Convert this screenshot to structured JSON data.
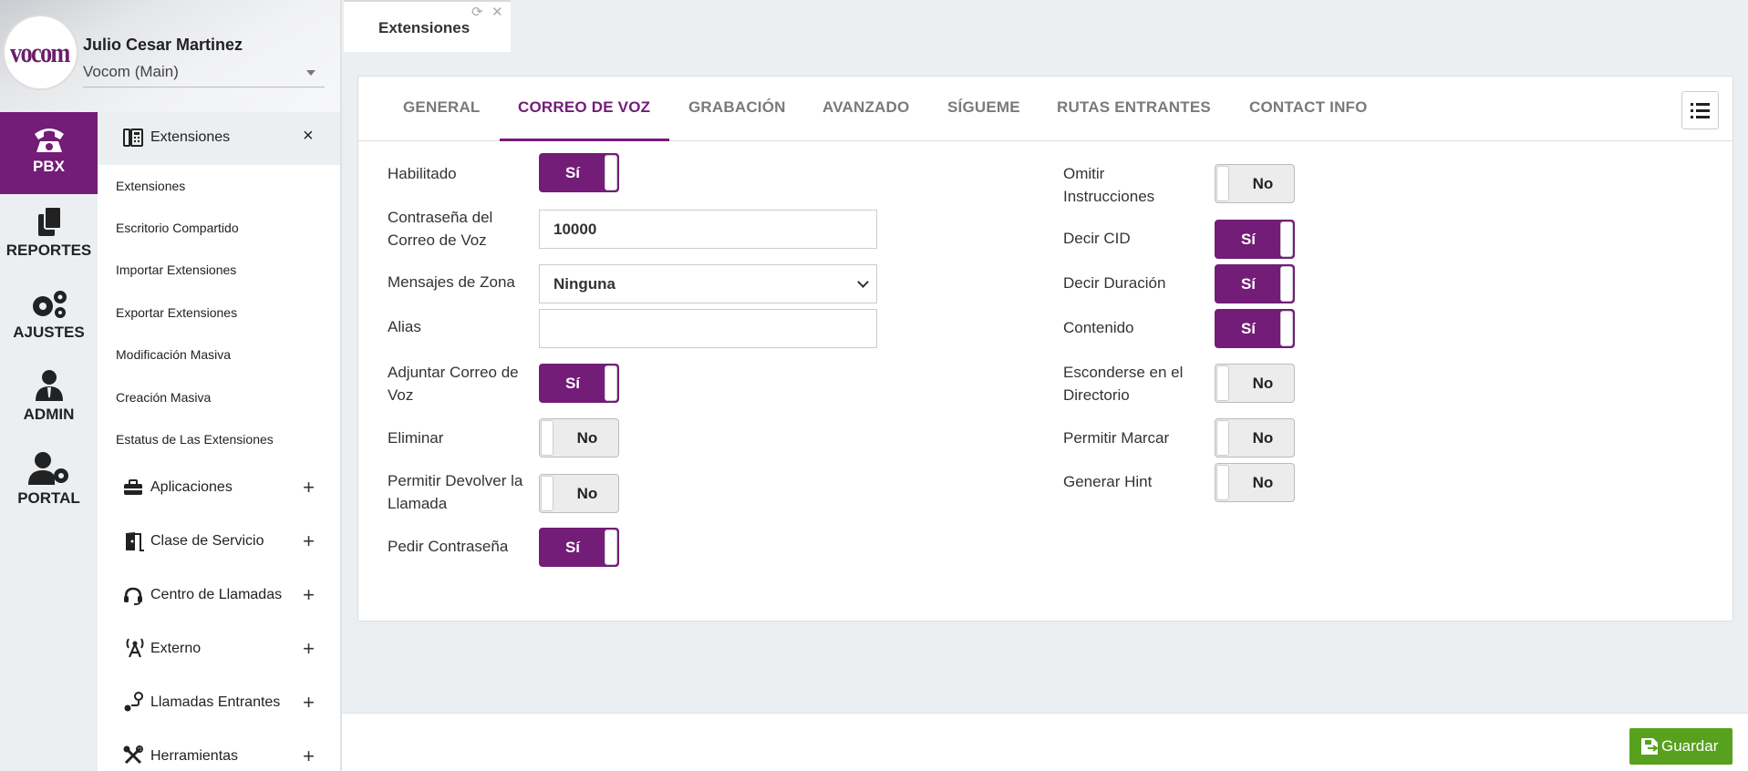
{
  "user": {
    "name": "Julio Cesar Martinez",
    "company": "Vocom (Main)",
    "logo_text": "vocom"
  },
  "rail": {
    "items": [
      {
        "label": "PBX"
      },
      {
        "label": "REPORTES"
      },
      {
        "label": "AJUSTES"
      },
      {
        "label": "ADMIN"
      },
      {
        "label": "PORTAL"
      }
    ]
  },
  "menu": {
    "header": {
      "label": "Extensiones",
      "close": "×"
    },
    "subitems": [
      "Extensiones",
      "Escritorio Compartido",
      "Importar Extensiones",
      "Exportar Extensiones",
      "Modificación Masiva",
      "Creación Masiva",
      "Estatus de Las Extensiones"
    ],
    "sections": [
      {
        "label": "Aplicaciones"
      },
      {
        "label": "Clase de Servicio"
      },
      {
        "label": "Centro de Llamadas"
      },
      {
        "label": "Externo"
      },
      {
        "label": "Llamadas Entrantes"
      },
      {
        "label": "Herramientas"
      }
    ],
    "expand_symbol": "+"
  },
  "page_tab": {
    "label": "Extensiones"
  },
  "tabs": [
    "GENERAL",
    "CORREO DE VOZ",
    "GRABACIÓN",
    "AVANZADO",
    "SÍGUEME",
    "RUTAS ENTRANTES",
    "CONTACT INFO"
  ],
  "active_tab": "CORREO DE VOZ",
  "left_fields": [
    {
      "label": "Habilitado",
      "type": "toggle",
      "value": "Sí"
    },
    {
      "label": "Contraseña del Correo de Voz",
      "type": "text",
      "value": "10000"
    },
    {
      "label": "Mensajes de Zona",
      "type": "select",
      "value": "Ninguna"
    },
    {
      "label": "Alias",
      "type": "text",
      "value": ""
    },
    {
      "label": "Adjuntar Correo de Voz",
      "type": "toggle",
      "value": "Sí"
    },
    {
      "label": "Eliminar",
      "type": "toggle",
      "value": "No"
    },
    {
      "label": "Permitir Devolver la Llamada",
      "type": "toggle",
      "value": "No"
    },
    {
      "label": "Pedir Contraseña",
      "type": "toggle",
      "value": "Sí"
    }
  ],
  "right_fields": [
    {
      "label": "Omitir Instrucciones",
      "value": "No"
    },
    {
      "label": "Decir CID",
      "value": "Sí"
    },
    {
      "label": "Decir Duración",
      "value": "Sí"
    },
    {
      "label": "Contenido",
      "value": "Sí"
    },
    {
      "label": "Esconderse en el Directorio",
      "value": "No"
    },
    {
      "label": "Permitir Marcar",
      "value": "No"
    },
    {
      "label": "Generar Hint",
      "value": "No"
    }
  ],
  "save_label": "Guardar",
  "colors": {
    "brand": "#731c78",
    "save": "#58a11e",
    "toggle_off": "#ececec"
  },
  "icons": [
    "phone-icon",
    "reports-icon",
    "gears-icon",
    "admin-icon",
    "portal-icon",
    "extensions-icon",
    "briefcase-icon",
    "door-icon",
    "headset-icon",
    "antenna-icon",
    "route-icon",
    "tools-icon",
    "refresh-icon",
    "close-icon",
    "list-icon",
    "save-icon"
  ]
}
